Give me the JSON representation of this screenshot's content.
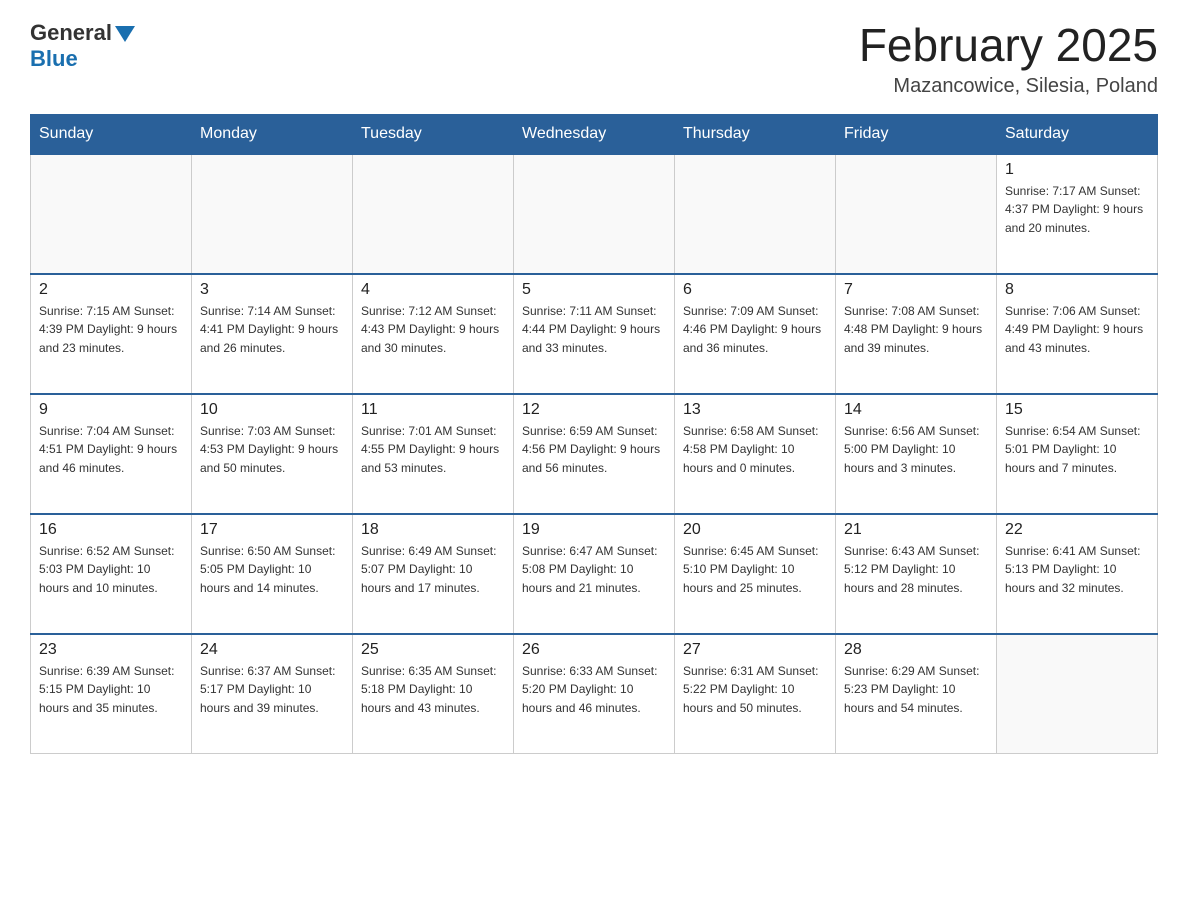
{
  "header": {
    "logo_general": "General",
    "logo_blue": "Blue",
    "title": "February 2025",
    "subtitle": "Mazancowice, Silesia, Poland"
  },
  "days_of_week": [
    "Sunday",
    "Monday",
    "Tuesday",
    "Wednesday",
    "Thursday",
    "Friday",
    "Saturday"
  ],
  "weeks": [
    [
      {
        "day": "",
        "info": ""
      },
      {
        "day": "",
        "info": ""
      },
      {
        "day": "",
        "info": ""
      },
      {
        "day": "",
        "info": ""
      },
      {
        "day": "",
        "info": ""
      },
      {
        "day": "",
        "info": ""
      },
      {
        "day": "1",
        "info": "Sunrise: 7:17 AM\nSunset: 4:37 PM\nDaylight: 9 hours and 20 minutes."
      }
    ],
    [
      {
        "day": "2",
        "info": "Sunrise: 7:15 AM\nSunset: 4:39 PM\nDaylight: 9 hours and 23 minutes."
      },
      {
        "day": "3",
        "info": "Sunrise: 7:14 AM\nSunset: 4:41 PM\nDaylight: 9 hours and 26 minutes."
      },
      {
        "day": "4",
        "info": "Sunrise: 7:12 AM\nSunset: 4:43 PM\nDaylight: 9 hours and 30 minutes."
      },
      {
        "day": "5",
        "info": "Sunrise: 7:11 AM\nSunset: 4:44 PM\nDaylight: 9 hours and 33 minutes."
      },
      {
        "day": "6",
        "info": "Sunrise: 7:09 AM\nSunset: 4:46 PM\nDaylight: 9 hours and 36 minutes."
      },
      {
        "day": "7",
        "info": "Sunrise: 7:08 AM\nSunset: 4:48 PM\nDaylight: 9 hours and 39 minutes."
      },
      {
        "day": "8",
        "info": "Sunrise: 7:06 AM\nSunset: 4:49 PM\nDaylight: 9 hours and 43 minutes."
      }
    ],
    [
      {
        "day": "9",
        "info": "Sunrise: 7:04 AM\nSunset: 4:51 PM\nDaylight: 9 hours and 46 minutes."
      },
      {
        "day": "10",
        "info": "Sunrise: 7:03 AM\nSunset: 4:53 PM\nDaylight: 9 hours and 50 minutes."
      },
      {
        "day": "11",
        "info": "Sunrise: 7:01 AM\nSunset: 4:55 PM\nDaylight: 9 hours and 53 minutes."
      },
      {
        "day": "12",
        "info": "Sunrise: 6:59 AM\nSunset: 4:56 PM\nDaylight: 9 hours and 56 minutes."
      },
      {
        "day": "13",
        "info": "Sunrise: 6:58 AM\nSunset: 4:58 PM\nDaylight: 10 hours and 0 minutes."
      },
      {
        "day": "14",
        "info": "Sunrise: 6:56 AM\nSunset: 5:00 PM\nDaylight: 10 hours and 3 minutes."
      },
      {
        "day": "15",
        "info": "Sunrise: 6:54 AM\nSunset: 5:01 PM\nDaylight: 10 hours and 7 minutes."
      }
    ],
    [
      {
        "day": "16",
        "info": "Sunrise: 6:52 AM\nSunset: 5:03 PM\nDaylight: 10 hours and 10 minutes."
      },
      {
        "day": "17",
        "info": "Sunrise: 6:50 AM\nSunset: 5:05 PM\nDaylight: 10 hours and 14 minutes."
      },
      {
        "day": "18",
        "info": "Sunrise: 6:49 AM\nSunset: 5:07 PM\nDaylight: 10 hours and 17 minutes."
      },
      {
        "day": "19",
        "info": "Sunrise: 6:47 AM\nSunset: 5:08 PM\nDaylight: 10 hours and 21 minutes."
      },
      {
        "day": "20",
        "info": "Sunrise: 6:45 AM\nSunset: 5:10 PM\nDaylight: 10 hours and 25 minutes."
      },
      {
        "day": "21",
        "info": "Sunrise: 6:43 AM\nSunset: 5:12 PM\nDaylight: 10 hours and 28 minutes."
      },
      {
        "day": "22",
        "info": "Sunrise: 6:41 AM\nSunset: 5:13 PM\nDaylight: 10 hours and 32 minutes."
      }
    ],
    [
      {
        "day": "23",
        "info": "Sunrise: 6:39 AM\nSunset: 5:15 PM\nDaylight: 10 hours and 35 minutes."
      },
      {
        "day": "24",
        "info": "Sunrise: 6:37 AM\nSunset: 5:17 PM\nDaylight: 10 hours and 39 minutes."
      },
      {
        "day": "25",
        "info": "Sunrise: 6:35 AM\nSunset: 5:18 PM\nDaylight: 10 hours and 43 minutes."
      },
      {
        "day": "26",
        "info": "Sunrise: 6:33 AM\nSunset: 5:20 PM\nDaylight: 10 hours and 46 minutes."
      },
      {
        "day": "27",
        "info": "Sunrise: 6:31 AM\nSunset: 5:22 PM\nDaylight: 10 hours and 50 minutes."
      },
      {
        "day": "28",
        "info": "Sunrise: 6:29 AM\nSunset: 5:23 PM\nDaylight: 10 hours and 54 minutes."
      },
      {
        "day": "",
        "info": ""
      }
    ]
  ]
}
